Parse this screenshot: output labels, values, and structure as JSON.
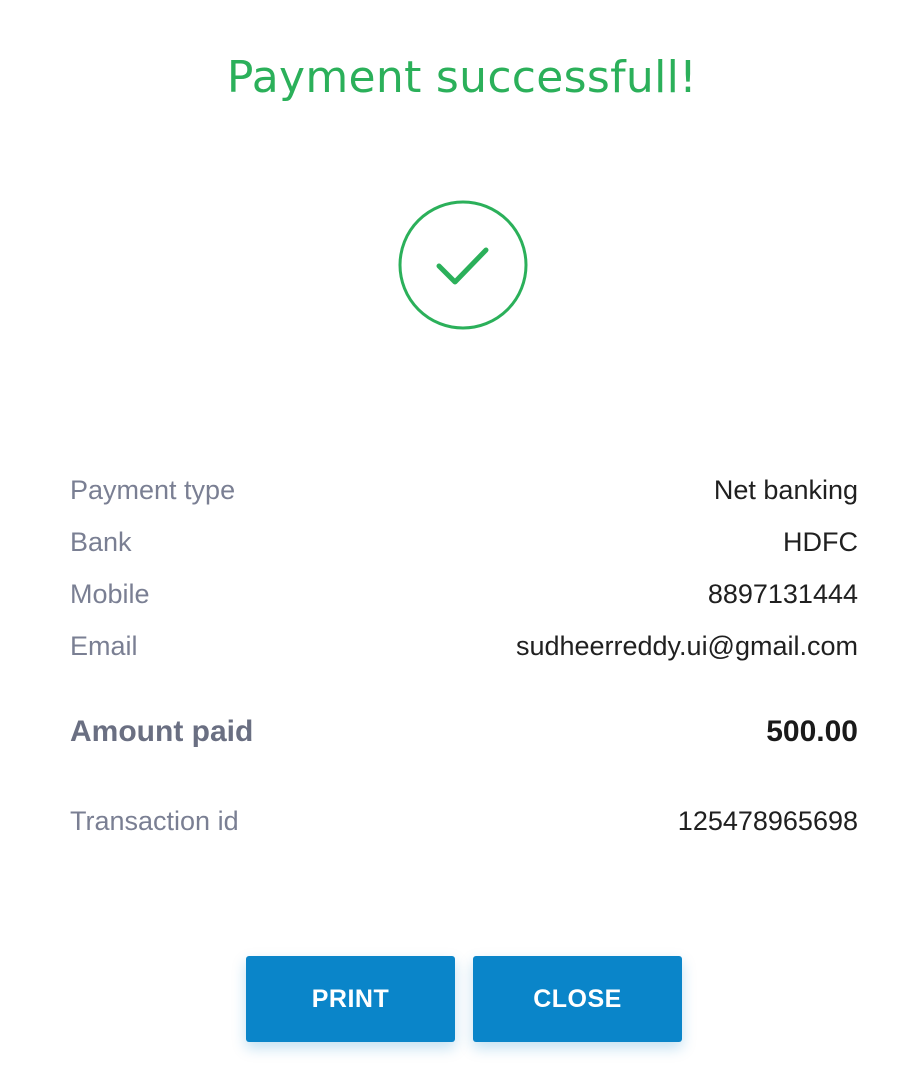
{
  "header": {
    "title": "Payment successfull!"
  },
  "status_icon": "check-circle-icon",
  "colors": {
    "success": "#2bb05a",
    "button": "#0a85c9",
    "label": "#7a7f93",
    "value": "#202020"
  },
  "details": {
    "payment_type": {
      "label": "Payment type",
      "value": "Net banking"
    },
    "bank": {
      "label": "Bank",
      "value": "HDFC"
    },
    "mobile": {
      "label": "Mobile",
      "value": "8897131444"
    },
    "email": {
      "label": "Email",
      "value": "sudheerreddy.ui@gmail.com"
    },
    "amount": {
      "label": "Amount paid",
      "value": "500.00"
    },
    "transaction": {
      "label": "Transaction id",
      "value": "125478965698"
    }
  },
  "actions": {
    "print_label": "PRINT",
    "close_label": "CLOSE"
  }
}
